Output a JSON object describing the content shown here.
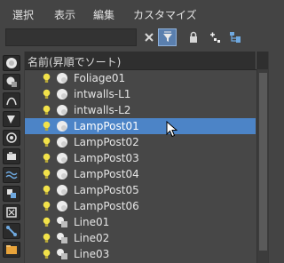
{
  "menu": [
    "選択",
    "表示",
    "編集",
    "カスタマイズ"
  ],
  "search": {
    "value": "",
    "placeholder": ""
  },
  "toolbar_icons": [
    "clear-icon",
    "filter-icon",
    "lock-icon",
    "link-icon",
    "hierarchy-icon"
  ],
  "column_header": "名前(昇順でソート)",
  "rows": [
    {
      "label": "Foliage01",
      "type": "object",
      "selected": false
    },
    {
      "label": "intwalls-L1",
      "type": "object",
      "selected": false
    },
    {
      "label": "intwalls-L2",
      "type": "object",
      "selected": false
    },
    {
      "label": "LampPost01",
      "type": "object",
      "selected": true
    },
    {
      "label": "LampPost02",
      "type": "object",
      "selected": false
    },
    {
      "label": "LampPost03",
      "type": "object",
      "selected": false
    },
    {
      "label": "LampPost04",
      "type": "object",
      "selected": false
    },
    {
      "label": "LampPost05",
      "type": "object",
      "selected": false
    },
    {
      "label": "LampPost06",
      "type": "object",
      "selected": false
    },
    {
      "label": "Line01",
      "type": "shape",
      "selected": false
    },
    {
      "label": "Line02",
      "type": "shape",
      "selected": false
    },
    {
      "label": "Line03",
      "type": "shape",
      "selected": false
    }
  ],
  "side_filters": [
    "display-all-icon",
    "geometry-icon",
    "shapes-icon",
    "lights-icon",
    "cameras-icon",
    "helpers-icon",
    "spacewarps-icon",
    "groups-icon",
    "xrefs-icon",
    "bones-icon",
    "containers-icon",
    "frozen-icon"
  ],
  "colors": {
    "selection": "#4c84c7",
    "background": "#444444",
    "bulb": "#f2e24a"
  }
}
